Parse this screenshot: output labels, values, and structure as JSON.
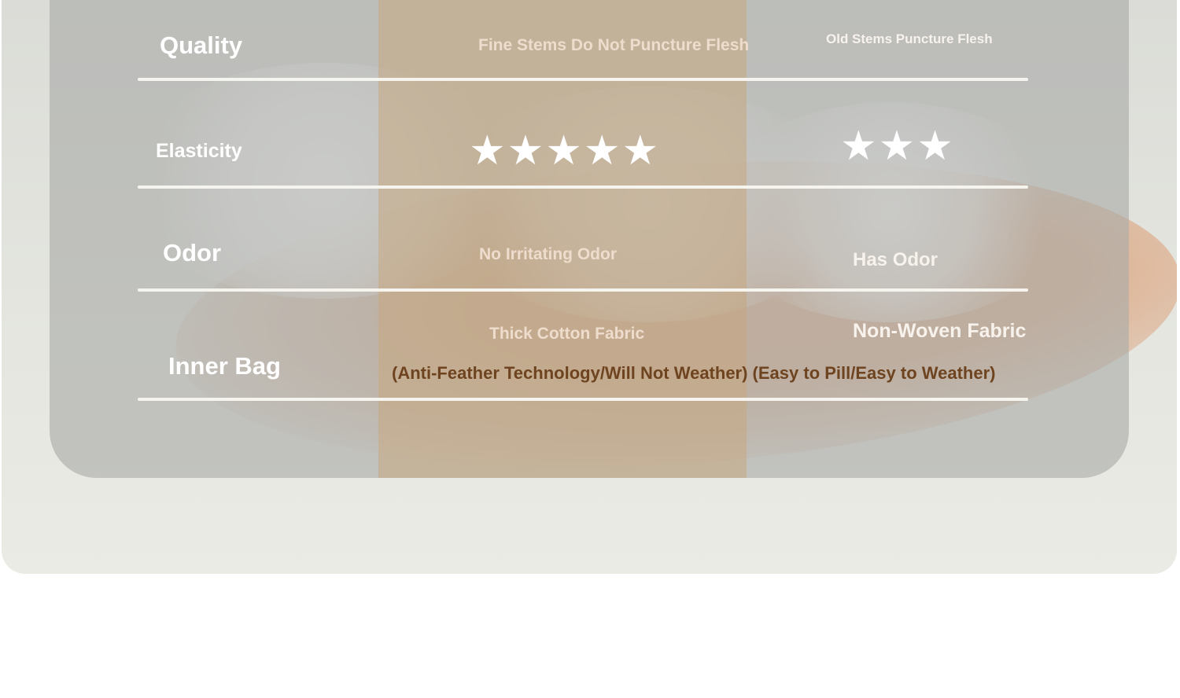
{
  "rows": [
    {
      "label": "Quality",
      "ours": "Fine Stems Do Not Puncture Flesh",
      "theirs": "Old Stems Puncture Flesh"
    },
    {
      "label": "Elasticity",
      "ours_rating": 5,
      "theirs_rating": 3,
      "ours_stars": "★★★★★",
      "theirs_stars": "★★★"
    },
    {
      "label": "Odor",
      "ours": "No Irritating Odor",
      "theirs": "Has Odor"
    },
    {
      "label": "Inner Bag",
      "ours": "Thick Cotton Fabric",
      "theirs": "Non-Woven Fabric",
      "footnote": "(Anti-Feather Technology/Will Not Weather) (Easy to Pill/Easy to Weather)"
    }
  ],
  "colors": {
    "card": "#a9aaa7",
    "middle_column": "#c6a880",
    "divider": "#f6f4ef",
    "footnote": "#6e4420",
    "label": "#ffffff"
  },
  "icons": [
    "star-icon"
  ]
}
